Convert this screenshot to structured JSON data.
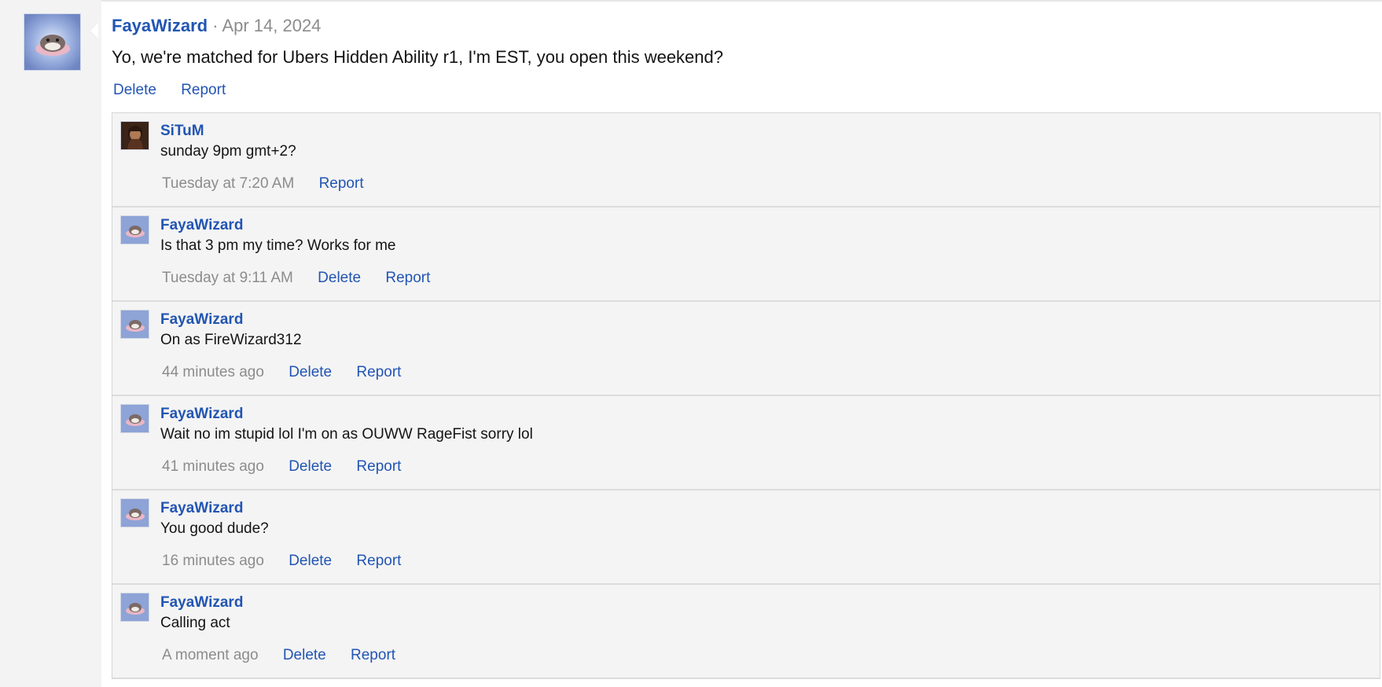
{
  "post": {
    "author": "FayaWizard",
    "separator": "·",
    "date": "Apr 14, 2024",
    "message": "Yo, we're matched for Ubers Hidden Ability r1, I'm EST, you open this weekend?",
    "actions": {
      "delete": "Delete",
      "report": "Report"
    }
  },
  "comments": [
    {
      "author": "SiTuM",
      "text": "sunday 9pm gmt+2?",
      "time": "Tuesday at 7:20 AM",
      "delete": "",
      "report": "Report",
      "avatar": "portrait-avatar"
    },
    {
      "author": "FayaWizard",
      "text": "Is that 3 pm my time? Works for me",
      "time": "Tuesday at 9:11 AM",
      "delete": "Delete",
      "report": "Report",
      "avatar": "creature-avatar"
    },
    {
      "author": "FayaWizard",
      "text": "On as FireWizard312",
      "time": "44 minutes ago",
      "delete": "Delete",
      "report": "Report",
      "avatar": "creature-avatar"
    },
    {
      "author": "FayaWizard",
      "text": "Wait no im stupid lol I'm on as OUWW RageFist sorry lol",
      "time": "41 minutes ago",
      "delete": "Delete",
      "report": "Report",
      "avatar": "creature-avatar"
    },
    {
      "author": "FayaWizard",
      "text": "You good dude?",
      "time": "16 minutes ago",
      "delete": "Delete",
      "report": "Report",
      "avatar": "creature-avatar"
    },
    {
      "author": "FayaWizard",
      "text": "Calling act",
      "time": "A moment ago",
      "delete": "Delete",
      "report": "Report",
      "avatar": "creature-avatar"
    }
  ],
  "colors": {
    "link": "#2255b3",
    "muted": "#8c8c8c",
    "comment_bg": "#f4f4f4"
  }
}
